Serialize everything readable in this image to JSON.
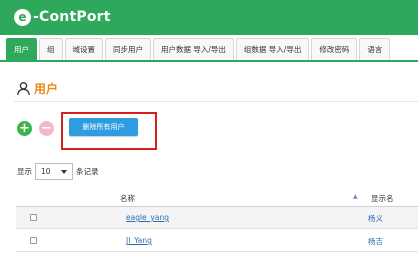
{
  "brand": {
    "logo_mark": "e",
    "name": "-ContPort"
  },
  "tabs": [
    {
      "label": "用户"
    },
    {
      "label": "组"
    },
    {
      "label": "域设置"
    },
    {
      "label": "同步用户"
    },
    {
      "label": "用户数据 导入/导出"
    },
    {
      "label": "组数据 导入/导出"
    },
    {
      "label": "修改密码"
    },
    {
      "label": "语言"
    }
  ],
  "page": {
    "title": "用户",
    "icon": "user-icon"
  },
  "actions": {
    "add_label": "+",
    "remove_label": "−",
    "delete_all_label": "删除所有用户"
  },
  "pagination": {
    "show_label": "显示",
    "page_size": "10",
    "records_label": "条记录"
  },
  "table": {
    "columns": {
      "name": "名称",
      "display_name": "显示名"
    },
    "rows": [
      {
        "username": "eagle_yang",
        "display_name": "杨义"
      },
      {
        "username": "JI_Yang",
        "display_name": "杨吉"
      }
    ]
  },
  "colors": {
    "brand_green": "#2ea85a",
    "accent_orange": "#e8891a",
    "button_blue": "#2f9be0",
    "highlight_red": "#d32020"
  }
}
